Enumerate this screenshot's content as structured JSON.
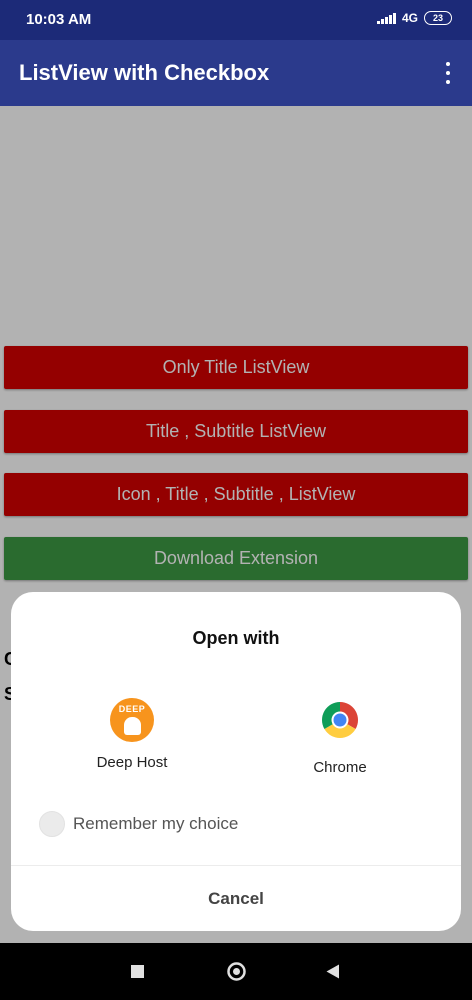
{
  "status_bar": {
    "time": "10:03 AM",
    "network": "4G",
    "battery": "23"
  },
  "app_bar": {
    "title": "ListView with Checkbox",
    "overflow_icon": "more-vert-icon"
  },
  "buttons": {
    "only_title": "Only Title ListView",
    "title_subtitle": "Title , Subtitle ListView",
    "icon_title_subtitle": "Icon , Title , Subtitle , ListView",
    "download_extension": "Download Extension"
  },
  "peek_text": {
    "line1": "C",
    "line2": "S"
  },
  "dialog": {
    "title": "Open with",
    "apps": [
      {
        "label": "Deep Host",
        "icon": "deep-host-icon",
        "icon_text": "DEEP"
      },
      {
        "label": "Chrome",
        "icon": "chrome-icon"
      }
    ],
    "remember_label": "Remember my choice",
    "cancel_label": "Cancel"
  },
  "colors": {
    "status_bar": "#1c2a78",
    "app_bar": "#2b3a8c",
    "button_red": "#d50000",
    "button_green": "#3d9a44"
  },
  "nav_bar": {
    "icons": [
      "recent-apps-icon",
      "home-icon",
      "back-icon"
    ]
  }
}
